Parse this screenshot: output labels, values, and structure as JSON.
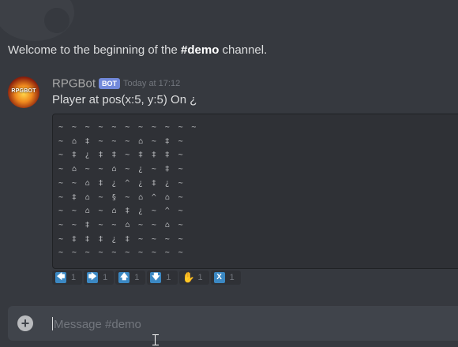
{
  "welcome": {
    "prefix": "Welcome to the beginning of the ",
    "channel": "#demo",
    "suffix": " channel."
  },
  "message": {
    "author": "RPGBot",
    "bot_tag": "BOT",
    "timestamp": "Today at 17:12",
    "text": "Player at pos(x:5, y:5) On ¿",
    "avatar_icon": "rpgbot-logo-icon",
    "avatar_text": "RPGBOT",
    "map": [
      "~ ~ ~ ~ ~ ~ ~ ~ ~ ~ ~",
      "~ ⌂ ‡ ~ ~ ~ ⌂ ~ ‡ ~",
      "~ ‡ ¿ ‡ ‡ ~ ‡ ‡ ‡ ~",
      "~ ⌂ ~ ~ ⌂ ~ ¿ ~ ‡ ~",
      "~ ~ ⌂ ‡ ¿ ^ ¿ ‡ ¿ ~",
      "~ ‡ ⌂ ~ § ~ ⌂ ^ ⌂ ~",
      "~ ~ ⌂ ~ ⌂ ‡ ¿ ~ ^ ~",
      "~ ~ ‡ ~ ~ ⌂ ~ ~ ⌂ ~",
      "~ ‡ ‡ ‡ ¿ ‡ ~ ~ ~ ~",
      "~ ~ ~ ~ ~ ~ ~ ~ ~ ~"
    ]
  },
  "reactions": [
    {
      "icon": "arrow-left-icon",
      "glyph": "🡄",
      "count": "1"
    },
    {
      "icon": "arrow-right-icon",
      "glyph": "🡆",
      "count": "1"
    },
    {
      "icon": "arrow-up-icon",
      "glyph": "🡅",
      "count": "1"
    },
    {
      "icon": "arrow-down-icon",
      "glyph": "🡇",
      "count": "1"
    },
    {
      "icon": "raised-hand-icon",
      "glyph": "✋",
      "count": "1"
    },
    {
      "icon": "x-icon",
      "glyph": "X",
      "count": "1"
    }
  ],
  "input": {
    "placeholder": "Message #demo",
    "add_icon": "plus-circle-icon"
  },
  "colors": {
    "background": "#36393f",
    "bot_tag": "#7289da",
    "code_bg": "#2f3136",
    "input_bg": "#40444b",
    "reaction_emoji": "#3b88c3"
  }
}
